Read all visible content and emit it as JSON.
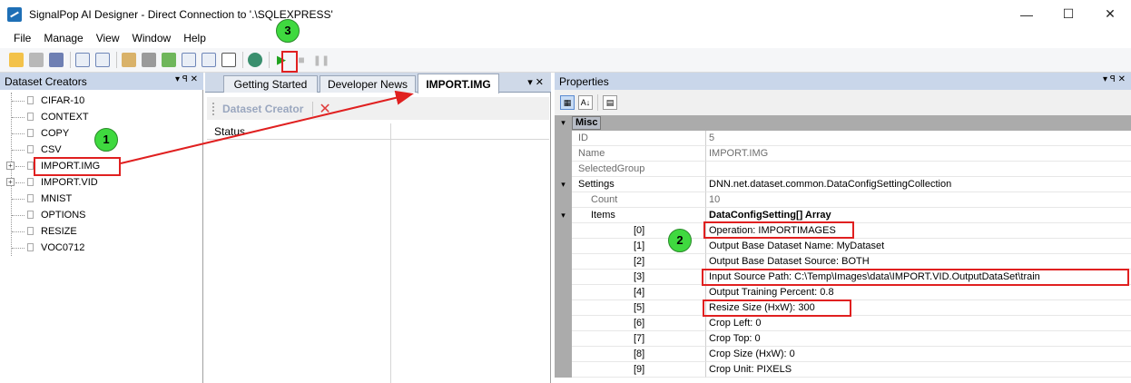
{
  "window": {
    "title": "SignalPop AI Designer - Direct Connection to '.\\SQLEXPRESS'",
    "min": "—",
    "max": "☐",
    "close": "✕"
  },
  "menu": [
    "File",
    "Manage",
    "View",
    "Window",
    "Help"
  ],
  "left_panel": {
    "title": "Dataset Creators",
    "pin": "▾  ꟼ  ✕",
    "items": [
      "CIFAR-10",
      "CONTEXT",
      "COPY",
      "CSV",
      "IMPORT.IMG",
      "IMPORT.VID",
      "MNIST",
      "OPTIONS",
      "RESIZE",
      "VOC0712"
    ]
  },
  "mid_panel": {
    "tabs": [
      "Getting Started",
      "Developer News",
      "IMPORT.IMG"
    ],
    "tab_ctrls": "▾  ✕",
    "dataset_creator_button": "Dataset Creator",
    "status_header": "Status"
  },
  "properties": {
    "title": "Properties",
    "pin": "▾  ꟼ  ✕",
    "category": "Misc",
    "rows": [
      {
        "name": "ID",
        "value": "5",
        "ro": true
      },
      {
        "name": "Name",
        "value": "IMPORT.IMG",
        "ro": true
      },
      {
        "name": "SelectedGroup",
        "value": "",
        "ro": true
      },
      {
        "name": "Settings",
        "value": "DNN.net.dataset.common.DataConfigSettingCollection",
        "ro": false
      },
      {
        "name": "Count",
        "value": "10",
        "ro": true
      },
      {
        "name": "Items",
        "value": "DataConfigSetting[] Array",
        "ro": false
      },
      {
        "name": "[0]",
        "value": "Operation: IMPORTIMAGES",
        "ro": false
      },
      {
        "name": "[1]",
        "value": "Output Base Dataset Name: MyDataset",
        "ro": false
      },
      {
        "name": "[2]",
        "value": "Output Base Dataset Source: BOTH",
        "ro": false
      },
      {
        "name": "[3]",
        "value": "Input Source Path: C:\\Temp\\Images\\data\\IMPORT.VID.OutputDataSet\\train",
        "ro": false
      },
      {
        "name": "[4]",
        "value": "Output Training Percent: 0.8",
        "ro": false
      },
      {
        "name": "[5]",
        "value": "Resize Size (HxW): 300",
        "ro": false
      },
      {
        "name": "[6]",
        "value": "Crop Left: 0",
        "ro": false
      },
      {
        "name": "[7]",
        "value": "Crop Top: 0",
        "ro": false
      },
      {
        "name": "[8]",
        "value": "Crop Size (HxW): 0",
        "ro": false
      },
      {
        "name": "[9]",
        "value": "Crop Unit: PIXELS",
        "ro": false
      }
    ]
  },
  "callouts": [
    "1",
    "2",
    "3"
  ],
  "colors": {
    "accent_red": "#e02020",
    "badge_green": "#3fd93f",
    "panel_header": "#c9d6ea"
  }
}
